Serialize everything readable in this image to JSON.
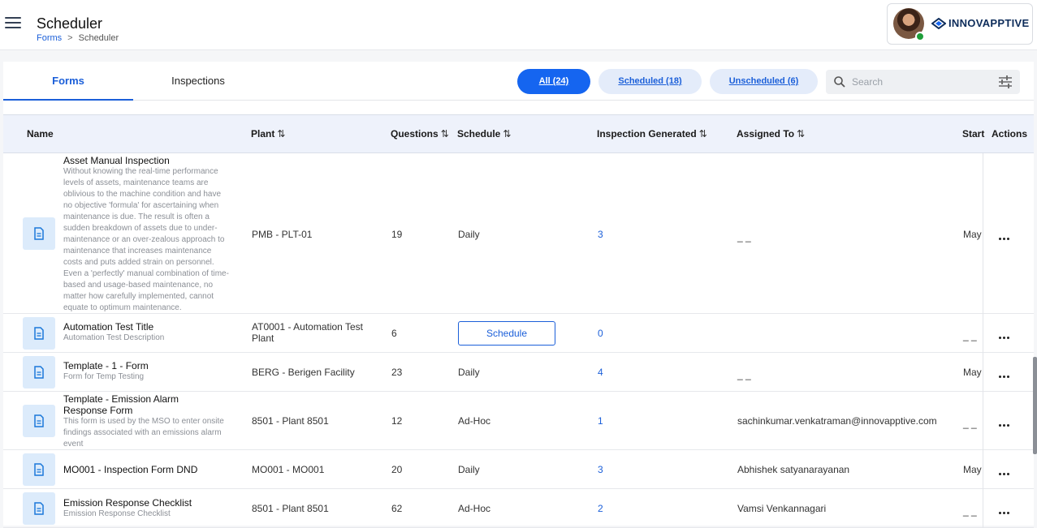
{
  "header": {
    "title": "Scheduler",
    "breadcrumb": {
      "link": "Forms",
      "separator": ">",
      "current": "Scheduler"
    },
    "brand": "INNOVAPPTIVE",
    "accent": "#1565f0"
  },
  "tabs": [
    {
      "label": "Forms",
      "active": true
    },
    {
      "label": "Inspections",
      "active": false
    }
  ],
  "filters": [
    {
      "label": "All (24)",
      "active": true
    },
    {
      "label": "Scheduled (18)",
      "active": false
    },
    {
      "label": "Unscheduled (6)",
      "active": false
    }
  ],
  "search": {
    "placeholder": "Search"
  },
  "columns": {
    "name": "Name",
    "plant": "Plant",
    "questions": "Questions",
    "schedule": "Schedule",
    "inspection_generated": "Inspection Generated",
    "assigned_to": "Assigned To",
    "start": "Start",
    "actions": "Actions",
    "sort_glyph": "⇅"
  },
  "rows": [
    {
      "title": "Asset Manual Inspection",
      "desc_lines": [
        "Without knowing the real-time performance",
        "levels of assets, maintenance teams are",
        "oblivious to the machine condition and have",
        "no objective 'formula' for ascertaining when",
        "maintenance is due. The result is often a",
        "sudden breakdown of assets due to under-",
        "maintenance or an over-zealous approach to",
        "maintenance that increases maintenance",
        "costs and puts added strain on personnel.",
        "Even a 'perfectly' manual combination of time-",
        "based and usage-based maintenance, no",
        "matter how carefully implemented, cannot",
        "equate to optimum maintenance."
      ],
      "plant": "PMB - PLT-01",
      "questions": "19",
      "schedule": "Daily",
      "inspection_generated": "3",
      "assigned_to": "_ _",
      "start": "May"
    },
    {
      "title": "Automation Test Title",
      "desc_lines": [
        "Automation Test Description"
      ],
      "plant": "AT0001 - Automation Test Plant",
      "questions": "6",
      "schedule_button": "Schedule",
      "inspection_generated": "0",
      "assigned_to": "",
      "start": "_ _"
    },
    {
      "title": "Template - 1 - Form",
      "desc_lines": [
        "Form for Temp Testing"
      ],
      "plant": "BERG - Berigen Facility",
      "questions": "23",
      "schedule": "Daily",
      "inspection_generated": "4",
      "assigned_to": "_ _",
      "start": "May"
    },
    {
      "title_lines": [
        "Template - Emission Alarm",
        "Response Form"
      ],
      "desc_lines": [
        "This form is used by the MSO to enter onsite",
        "findings associated with an emissions alarm",
        "event"
      ],
      "plant": "8501 - Plant 8501",
      "questions": "12",
      "schedule": "Ad-Hoc",
      "inspection_generated": "1",
      "assigned_to": "sachinkumar.venkatraman@innovapptive.com",
      "start": "_ _"
    },
    {
      "title": "MO001 - Inspection Form DND",
      "desc_lines": [],
      "plant": "MO001 - MO001",
      "questions": "20",
      "schedule": "Daily",
      "inspection_generated": "3",
      "assigned_to": "Abhishek satyanarayanan",
      "start": "May"
    },
    {
      "title": "Emission Response Checklist",
      "desc_lines": [
        "Emission Response Checklist"
      ],
      "plant": "8501 - Plant 8501",
      "questions": "62",
      "schedule": "Ad-Hoc",
      "inspection_generated": "2",
      "assigned_to": "Vamsi Venkannagari",
      "start": "_ _"
    }
  ]
}
